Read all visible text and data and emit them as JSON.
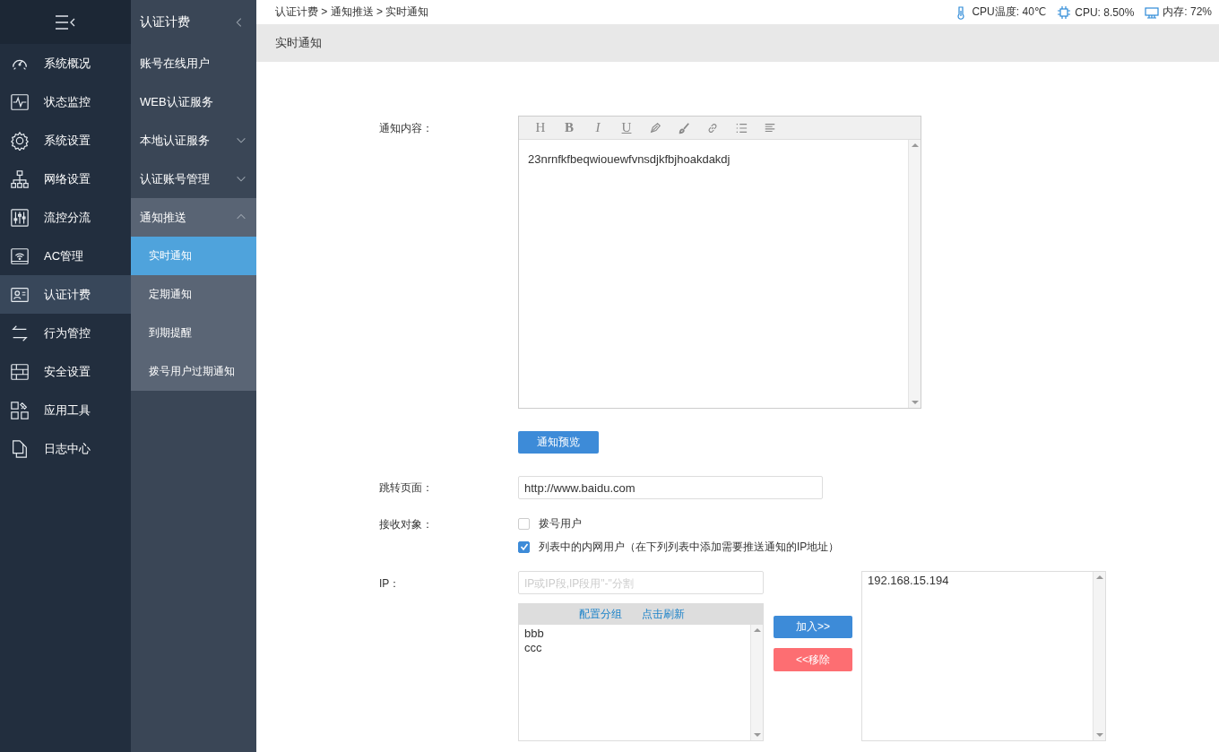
{
  "sidebar": {
    "items": [
      {
        "label": "系统概况",
        "selected": false
      },
      {
        "label": "状态监控",
        "selected": false
      },
      {
        "label": "系统设置",
        "selected": false
      },
      {
        "label": "网络设置",
        "selected": false
      },
      {
        "label": "流控分流",
        "selected": false
      },
      {
        "label": "AC管理",
        "selected": false
      },
      {
        "label": "认证计费",
        "selected": true
      },
      {
        "label": "行为管控",
        "selected": false
      },
      {
        "label": "安全设置",
        "selected": false
      },
      {
        "label": "应用工具",
        "selected": false
      },
      {
        "label": "日志中心",
        "selected": false
      }
    ]
  },
  "submenu": {
    "title": "认证计费",
    "items": [
      {
        "label": "账号在线用户",
        "kind": "link"
      },
      {
        "label": "WEB认证服务",
        "kind": "link"
      },
      {
        "label": "本地认证服务",
        "kind": "group",
        "expanded": false
      },
      {
        "label": "认证账号管理",
        "kind": "group",
        "expanded": false
      },
      {
        "label": "通知推送",
        "kind": "group",
        "expanded": true,
        "children": [
          {
            "label": "实时通知",
            "selected": true
          },
          {
            "label": "定期通知",
            "selected": false
          },
          {
            "label": "到期提醒",
            "selected": false
          },
          {
            "label": "拨号用户过期通知",
            "selected": false
          }
        ]
      }
    ]
  },
  "breadcrumb": [
    "认证计费",
    "通知推送",
    "实时通知"
  ],
  "breadcrumb_separator": ">",
  "status": [
    {
      "kind": "temperature",
      "text": "CPU温度: 40℃"
    },
    {
      "kind": "cpu",
      "text": "CPU: 8.50%"
    },
    {
      "kind": "memory",
      "text": "内存: 72%"
    }
  ],
  "page_title": "实时通知",
  "form": {
    "content_label": "通知内容：",
    "toolbar": [
      {
        "kind": "heading",
        "glyph": "H"
      },
      {
        "kind": "bold",
        "glyph": "B"
      },
      {
        "kind": "italic",
        "glyph": "I"
      },
      {
        "kind": "underline",
        "glyph": "U"
      },
      {
        "kind": "pen"
      },
      {
        "kind": "brush"
      },
      {
        "kind": "link"
      },
      {
        "kind": "list"
      },
      {
        "kind": "align"
      }
    ],
    "content": "23nrnfkfbeqwiouewfvnsdjkfbjhoakdakdj",
    "preview_button": "通知预览",
    "redirect_label": "跳转页面：",
    "redirect_value": "http://www.baidu.com",
    "receivers_label": "接收对象：",
    "receivers": [
      {
        "label": "拨号用户",
        "checked": false
      },
      {
        "label": "列表中的内网用户（在下列列表中添加需要推送通知的IP地址）",
        "checked": true
      }
    ],
    "ip_label": "IP：",
    "ip_placeholder": "IP或IP段,IP段用\"-\"分割",
    "group_links": [
      "配置分组",
      "点击刷新"
    ],
    "groups": [
      "bbb",
      "ccc"
    ],
    "add_button": "加入>>",
    "remove_button": "<<移除",
    "ip_list": [
      "192.168.15.194"
    ]
  }
}
